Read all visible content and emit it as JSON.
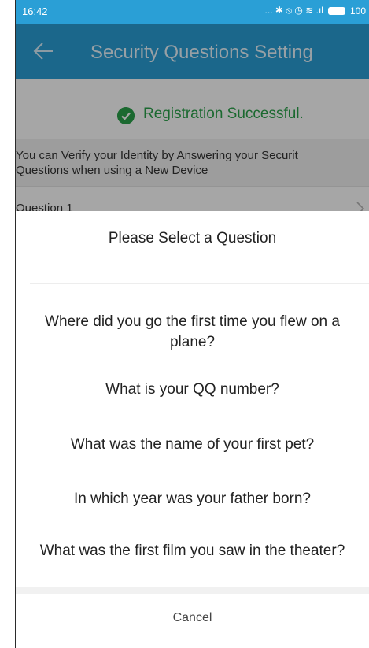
{
  "status_bar": {
    "time": "16:42",
    "icons_text": "... ✱ ⦸ ◷ ≋ .ıl",
    "battery": "100"
  },
  "app_bar": {
    "title": "Security Questions Setting",
    "back_icon": "arrow-left-icon",
    "background_color": "#2a9fd6"
  },
  "registration": {
    "message": "Registration Successful.",
    "icon": "check-circle-icon",
    "color": "#2aa24a"
  },
  "info": {
    "line1": "You can Verify your Identity by Answering your Securit",
    "line2": "Questions when using a New Device"
  },
  "question_row": {
    "label": "Question 1",
    "icon": "chevron-right-icon"
  },
  "sheet": {
    "title": "Please Select a Question",
    "options": [
      {
        "line1": "Where did you go the first time you flew on a",
        "line2": "plane?"
      },
      {
        "line1": "What is your QQ number?"
      },
      {
        "line1": "What was the name of your first pet?"
      },
      {
        "line1": "In which year was your father born?"
      },
      {
        "line1": "What was the first film you saw in the theater?"
      }
    ],
    "cancel_label": "Cancel"
  }
}
